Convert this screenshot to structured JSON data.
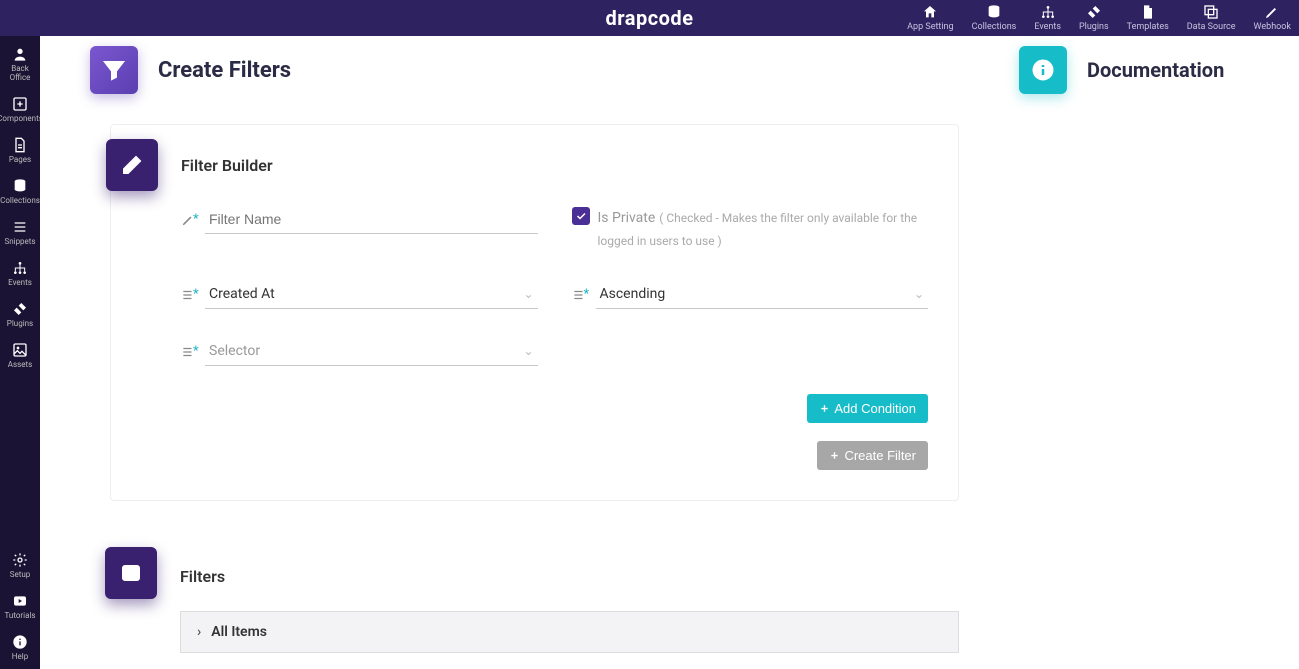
{
  "logo": "drapcode",
  "topnav": [
    {
      "label": "App Setting"
    },
    {
      "label": "Collections"
    },
    {
      "label": "Events"
    },
    {
      "label": "Plugins"
    },
    {
      "label": "Templates"
    },
    {
      "label": "Data Source"
    },
    {
      "label": "Webhook"
    }
  ],
  "sidenav_top": [
    {
      "label": "Back Office"
    },
    {
      "label": "Components"
    },
    {
      "label": "Pages"
    },
    {
      "label": "Collections"
    },
    {
      "label": "Snippets"
    },
    {
      "label": "Events"
    },
    {
      "label": "Plugins"
    },
    {
      "label": "Assets"
    }
  ],
  "sidenav_bottom": [
    {
      "label": "Setup"
    },
    {
      "label": "Tutorials"
    },
    {
      "label": "Help"
    }
  ],
  "page": {
    "title": "Create Filters",
    "doc_title": "Documentation"
  },
  "builder": {
    "title": "Filter Builder",
    "name_placeholder": "Filter Name",
    "name_value": "",
    "private_label": "Is Private",
    "private_checked": true,
    "private_help": "( Checked - Makes the filter only available for the logged in users to use )",
    "sort_field": "Created At",
    "sort_dir": "Ascending",
    "selector": "Selector",
    "add_condition_label": "Add Condition",
    "create_filter_label": "Create Filter"
  },
  "filters_section": {
    "title": "Filters",
    "all_items_label": "All Items"
  }
}
